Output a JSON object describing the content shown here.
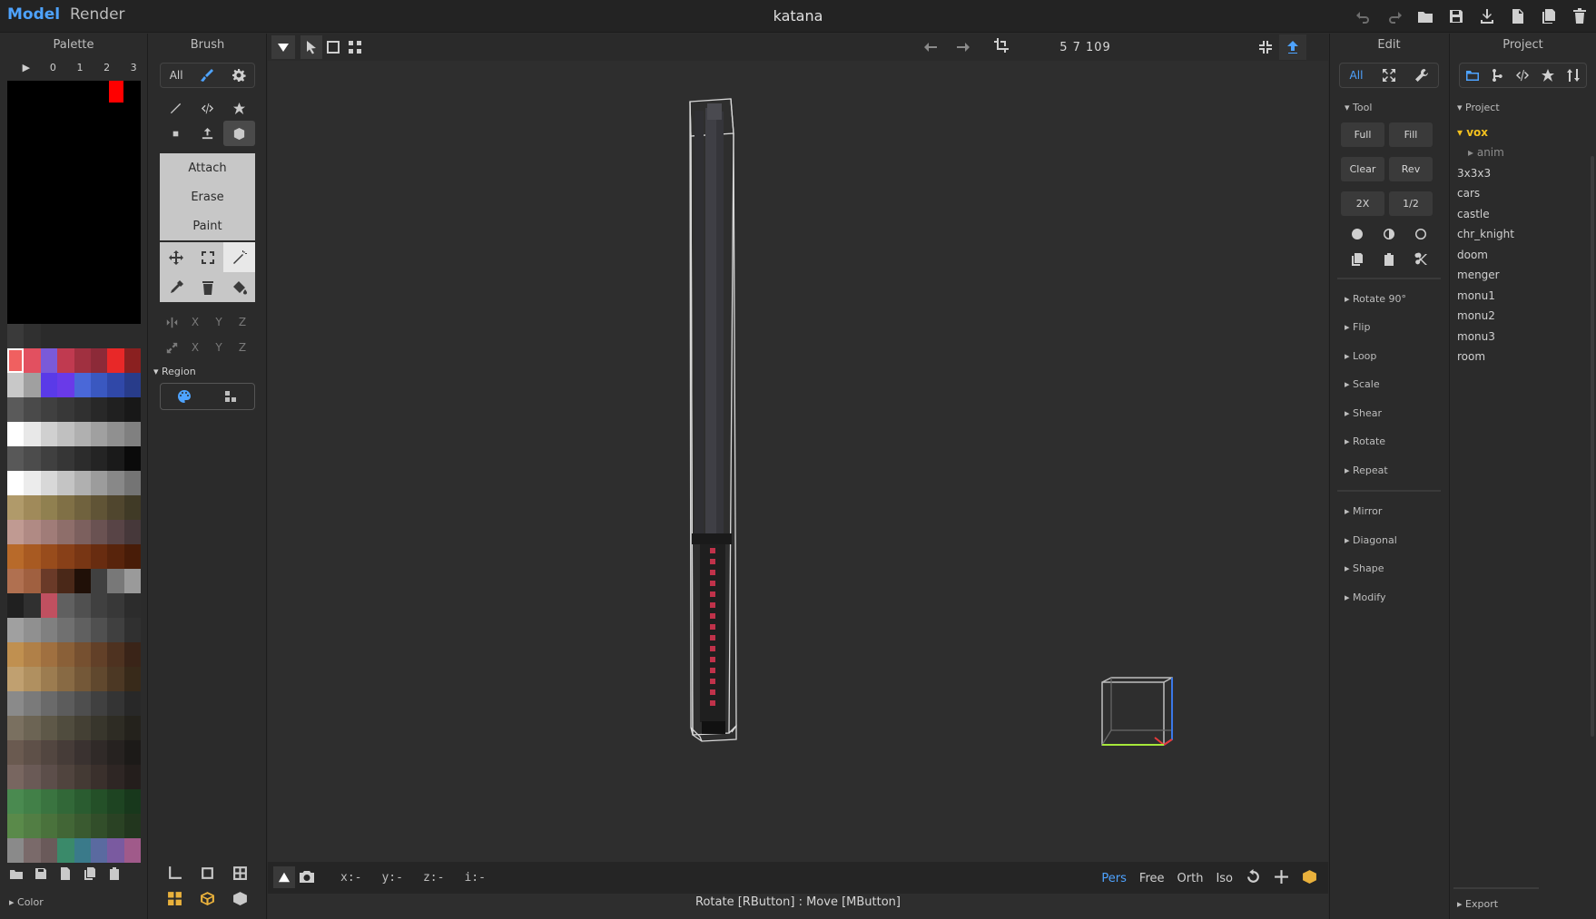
{
  "titlebar": {
    "mode_model": "Model",
    "mode_render": "Render",
    "title": "katana",
    "icons": [
      "undo-icon",
      "redo-icon",
      "open-icon",
      "save-icon",
      "import-icon",
      "new-file-icon",
      "copy-file-icon",
      "trash-icon"
    ]
  },
  "palette": {
    "title": "Palette",
    "tabs": [
      "▶",
      "0",
      "1",
      "2",
      "3"
    ],
    "footer_label": "▸ Color",
    "rows": [
      [
        "#3a3a3a",
        "#303030",
        "",
        "",
        "",
        "",
        "",
        ""
      ],
      [
        "#f06060",
        "#e25060",
        "#7a5ad8",
        "#c03a50",
        "#a03040",
        "#8c2a38",
        "#e82828",
        "#8a2020"
      ],
      [
        "#c8c8c8",
        "#a0a0a0",
        "#5a3ae8",
        "#6a3ae8",
        "#4a68d8",
        "#3a58c0",
        "#3048a8",
        "#283c8a"
      ],
      [
        "#5a5a5a",
        "#4a4a4a",
        "#404040",
        "#383838",
        "#303030",
        "#282828",
        "#202020",
        "#181818"
      ],
      [
        "#ffffff",
        "#e8e8e8",
        "#d0d0d0",
        "#c0c0c0",
        "#b0b0b0",
        "#a0a0a0",
        "#909090",
        "#808080"
      ],
      [
        "#585858",
        "#4c4c4c",
        "#404040",
        "#363636",
        "#2c2c2c",
        "#242424",
        "#1a1a1a",
        "#0a0a0a"
      ],
      [
        "#ffffff",
        "#ececec",
        "#d8d8d8",
        "#c4c4c4",
        "#b0b0b0",
        "#9c9c9c",
        "#888888",
        "#747474"
      ],
      [
        "#b09a6a",
        "#a08a5a",
        "#908050",
        "#807046",
        "#70623e",
        "#605436",
        "#50462e",
        "#403a26"
      ],
      [
        "#c09a92",
        "#b08a84",
        "#a07c78",
        "#8e6e6a",
        "#7c605e",
        "#6a5252",
        "#584446",
        "#46383a"
      ],
      [
        "#b86a2a",
        "#a85a22",
        "#984c1c",
        "#884018",
        "#783614",
        "#682c10",
        "#58240c",
        "#481c08"
      ],
      [
        "#b07050",
        "#a06040",
        "#6a3a28",
        "#4a2818",
        "#201008",
        "#404040",
        "#787878",
        "#9a9a9a"
      ],
      [
        "#202020",
        "#303030",
        "#c05060",
        "#606060",
        "#505050",
        "#404040",
        "#383838",
        "#2c2c2c"
      ],
      [
        "#a0a0a0",
        "#909090",
        "#808080",
        "#707070",
        "#606060",
        "#505050",
        "#404040",
        "#303030"
      ],
      [
        "#c09050",
        "#b08048",
        "#a07040",
        "#8a6038",
        "#765030",
        "#624028",
        "#4e3220",
        "#3a2418"
      ],
      [
        "#c0a070",
        "#b09060",
        "#9c7c50",
        "#886a44",
        "#745838",
        "#60482e",
        "#4c3824",
        "#382a1a"
      ],
      [
        "#8a8a8a",
        "#7a7a7a",
        "#6a6a6a",
        "#5c5c5c",
        "#4e4e4e",
        "#404040",
        "#343434",
        "#282828"
      ],
      [
        "#7a7060",
        "#6c6454",
        "#5e5848",
        "#504c3e",
        "#444034",
        "#38362c",
        "#2e2c24",
        "#24221c"
      ],
      [
        "#6a5a50",
        "#5e5048",
        "#524640",
        "#463c38",
        "#3a3230",
        "#302a28",
        "#262220",
        "#1c1a18"
      ],
      [
        "#786660",
        "#6a5a56",
        "#5c4e4a",
        "#50443e",
        "#443a34",
        "#3a302c",
        "#2e2624",
        "#241e1c"
      ],
      [
        "#4a8a50",
        "#428048",
        "#3a7440",
        "#326838",
        "#2a5c30",
        "#245028",
        "#1e4422",
        "#18381c"
      ],
      [
        "#5a8a4a",
        "#527e44",
        "#4a723c",
        "#426636",
        "#3a5a30",
        "#324e2a",
        "#2a4224",
        "#22361e"
      ],
      [
        "#8a8a8a",
        "#7a6a6a",
        "#6a5a5a",
        "#3a8a6a",
        "#3a7a8a",
        "#5a6aa0",
        "#7a5aa0",
        "#a05a8a"
      ]
    ],
    "footer_icons": [
      "folder-icon",
      "save-icon",
      "file-icon",
      "copy-icon",
      "clipboard-icon"
    ]
  },
  "brush": {
    "title": "Brush",
    "seg_all": "All",
    "modes": [
      "Attach",
      "Erase",
      "Paint"
    ],
    "axis_labels": [
      "X",
      "Y",
      "Z"
    ],
    "region_label": "▾ Region"
  },
  "viewport": {
    "dims": "5  7  109",
    "coords": [
      "x:-",
      "y:-",
      "z:-",
      "i:-"
    ],
    "view_modes": [
      "Pers",
      "Free",
      "Orth",
      "Iso"
    ],
    "active_view": "Pers",
    "status": "Rotate [RButton] : Move [MButton]"
  },
  "edit": {
    "title": "Edit",
    "seg_all": "All",
    "tool_label": "▾ Tool",
    "tool_buttons": [
      "Full",
      "Fill",
      "Clear",
      "Rev",
      "2X",
      "1/2"
    ],
    "sections_a": [
      "▸ Rotate 90°",
      "▸ Flip",
      "▸ Loop",
      "▸ Scale",
      "▸ Shear",
      "▸ Rotate",
      "▸ Repeat"
    ],
    "sections_b": [
      "▸ Mirror",
      "▸ Diagonal",
      "▸ Shape",
      "▸ Modify"
    ]
  },
  "project": {
    "title": "Project",
    "section_label": "▾ Project",
    "root": "▾ vox",
    "child": "▸ anim",
    "files": [
      "3x3x3",
      "cars",
      "castle",
      "chr_knight",
      "doom",
      "menger",
      "monu1",
      "monu2",
      "monu3",
      "room"
    ],
    "export_label": "▸ Export"
  },
  "colors": {
    "accent": "#4ea3ff",
    "folder_highlight": "#f3c11f",
    "palette_red": "#ff0000",
    "handle_wrap": "#c0324a"
  }
}
